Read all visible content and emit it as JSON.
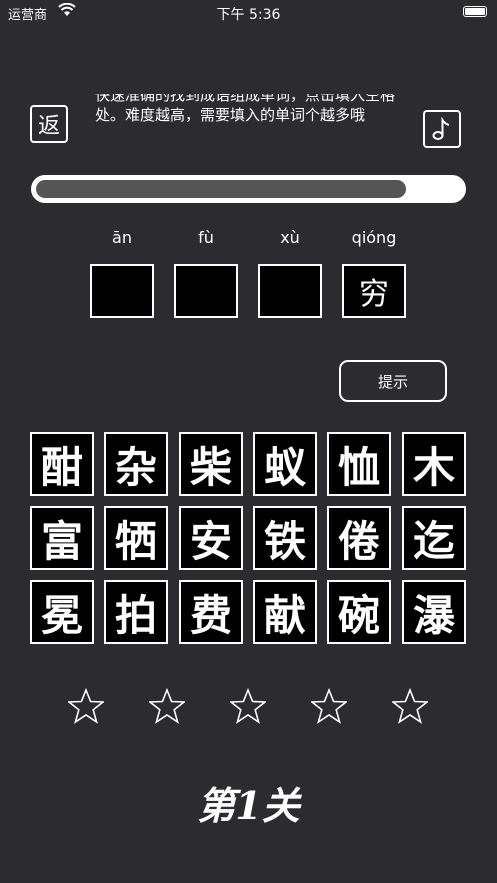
{
  "status_bar": {
    "carrier": "运营商",
    "time": "下午 5:36"
  },
  "header": {
    "back_label": "返",
    "instructions": "快速准确的找到成语组成单词，点击填入空格处。难度越高，需要填入的单词个越多哦"
  },
  "progress": {
    "value": 0.87
  },
  "answer": {
    "pinyin": [
      "ān",
      "fù",
      "xù",
      "qióng"
    ],
    "slots": [
      "",
      "",
      "",
      "穷"
    ]
  },
  "hint_label": "提示",
  "tiles": [
    [
      "酣",
      "杂",
      "柴",
      "蚁",
      "恤",
      "木"
    ],
    [
      "富",
      "牺",
      "安",
      "铁",
      "倦",
      "迄"
    ],
    [
      "冕",
      "拍",
      "费",
      "献",
      "碗",
      "瀑"
    ]
  ],
  "stars": {
    "total": 5,
    "filled": 0
  },
  "level_label": "第1关"
}
